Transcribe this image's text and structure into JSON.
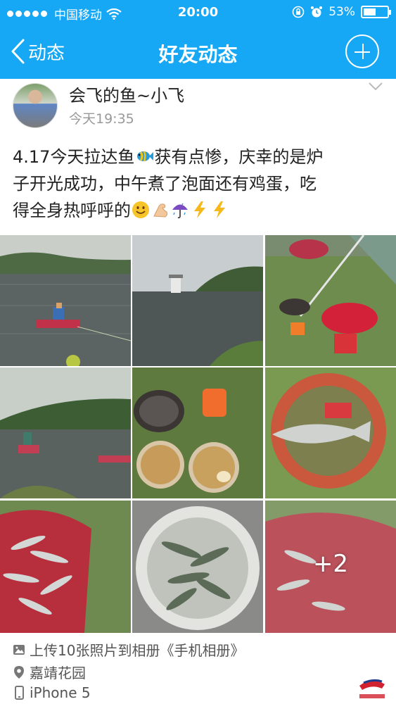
{
  "status_bar": {
    "carrier": "中国移动",
    "time": "20:00",
    "battery": "53%",
    "battery_level": 0.53
  },
  "nav": {
    "back_label": "动态",
    "title": "好友动态"
  },
  "post": {
    "author": "会飞的鱼~小飞",
    "time": "今天19:35",
    "text_line1": "4.17今天拉达鱼",
    "text_line1b": "获有点惨，庆幸的是炉",
    "text_line2": "子开光成功，中午煮了泡面还有鸡蛋，吃",
    "text_line3": "得全身热呼呼的",
    "emojis": [
      "tropical-fish",
      "smile",
      "flexed-bicep",
      "umbrella-rain",
      "lightning",
      "lightning"
    ],
    "more_photos": "+2"
  },
  "footer": {
    "upload": "上传10张照片到相册《手机相册》",
    "location": "嘉靖花园",
    "device": "iPhone 5"
  },
  "colors": {
    "nav_bg": "#16a8f5",
    "text": "#222222",
    "muted": "#999999"
  }
}
